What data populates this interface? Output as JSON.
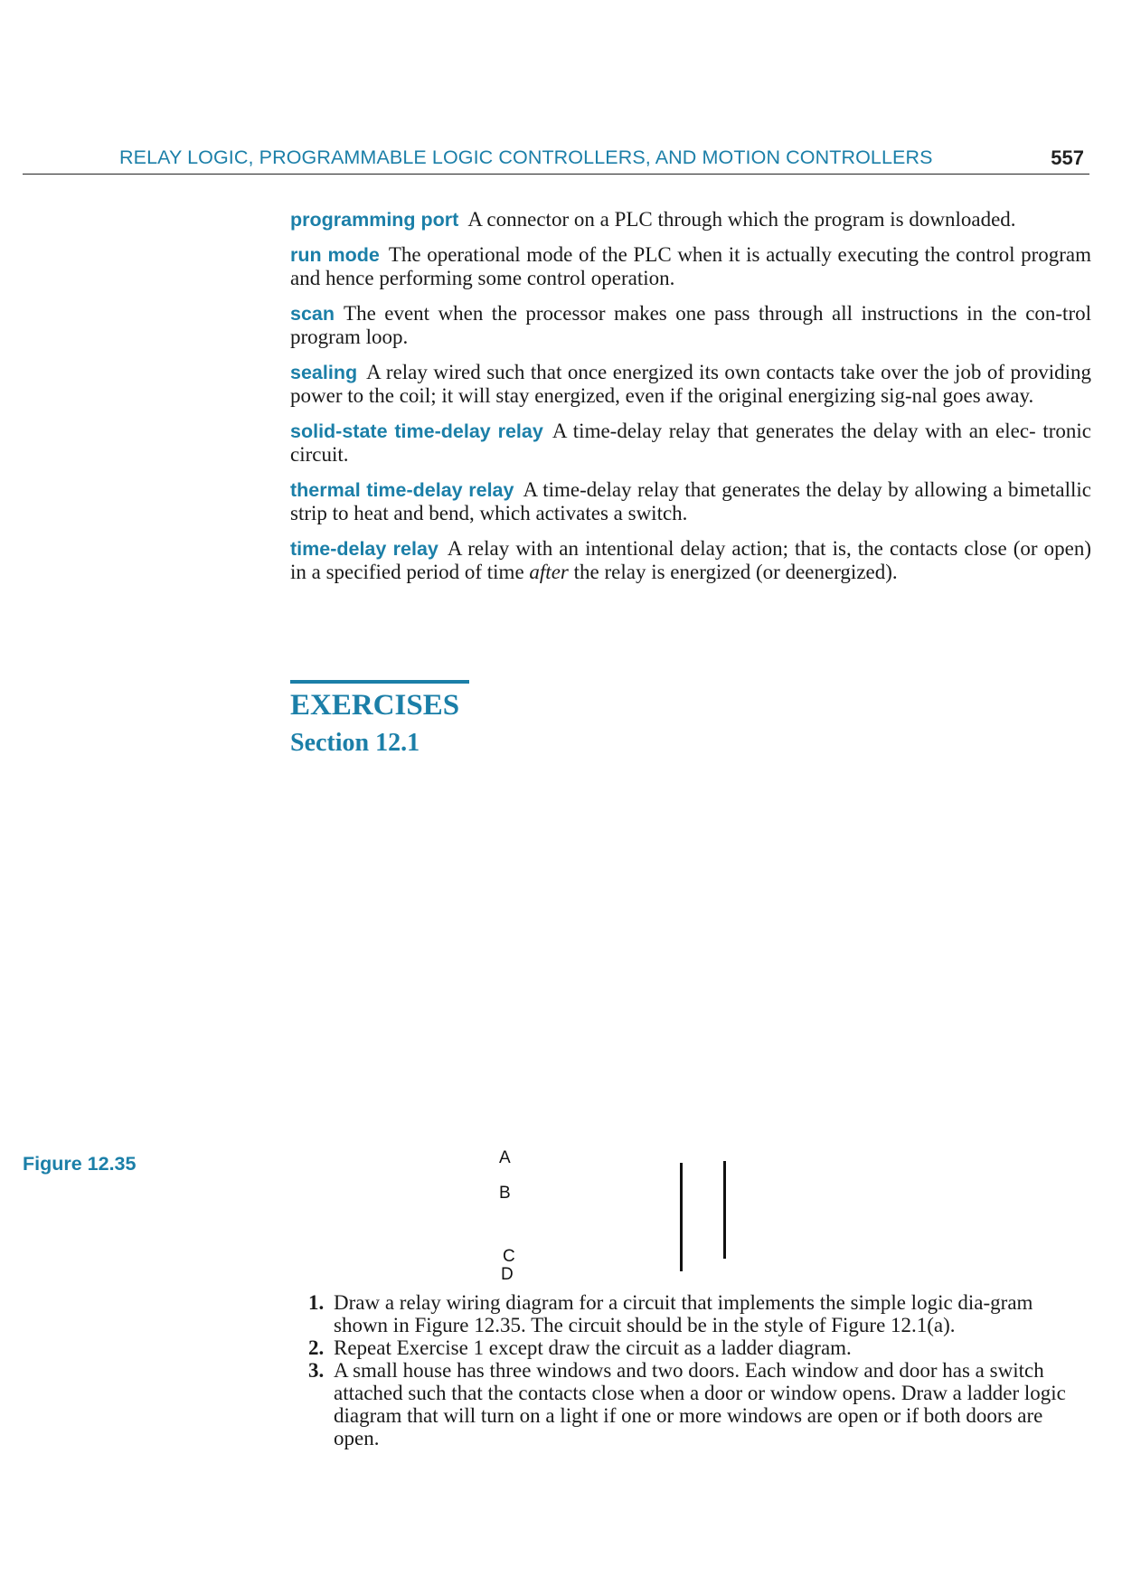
{
  "header": {
    "running_title": "RELAY LOGIC, PROGRAMMABLE LOGIC CONTROLLERS, AND MOTION CONTROLLERS",
    "page_number": "557"
  },
  "glossary": [
    {
      "term": "programming port",
      "definition": "A connector on a PLC through which the program is downloaded."
    },
    {
      "term": "run mode",
      "definition": "The operational mode of the PLC when it is actually executing the control program and hence performing some control operation."
    },
    {
      "term": "scan",
      "definition": "The event when the processor makes one pass through all instructions in the con-trol program loop."
    },
    {
      "term": "sealing",
      "definition": "A relay wired such that once energized its own contacts take over the job of providing power to the coil; it will stay energized, even if the original energizing sig-nal goes away."
    },
    {
      "term": "solid-state time-delay relay",
      "definition": "A time-delay relay that generates the delay with an elec-  tronic circuit."
    },
    {
      "term": "thermal time-delay relay",
      "definition": "A time-delay relay that generates the delay by allowing a bimetallic strip to heat and bend, which activates a switch."
    },
    {
      "term": "time-delay relay",
      "definition_before": "A relay with an intentional delay action; that is, the contacts close (or open) in a specified period of time ",
      "definition_emphasis": "after",
      "definition_after": " the relay is energized (or deenergized)."
    }
  ],
  "exercises": {
    "heading": "EXERCISES",
    "section": "Section 12.1",
    "items": [
      {
        "number": "1.",
        "text": "Draw a relay wiring diagram for a circuit that implements the simple logic dia-gram shown in Figure 12.35. The circuit should be in the style of Figure 12.1(a)."
      },
      {
        "number": "2.",
        "text": "Repeat Exercise 1 except draw the circuit as a ladder diagram."
      },
      {
        "number": "3.",
        "text": "A small house has three windows and two doors. Each window and door has a switch attached such that the contacts close when a door or window opens. Draw a ladder logic diagram that will turn on a light if one or more windows are open or if both doors are open."
      }
    ]
  },
  "figure": {
    "label": "Figure 12.35",
    "inputs": [
      "A",
      "B",
      "C",
      "D"
    ]
  },
  "colors": {
    "accent": "#1b7fa8",
    "text": "#1a1a1a"
  }
}
